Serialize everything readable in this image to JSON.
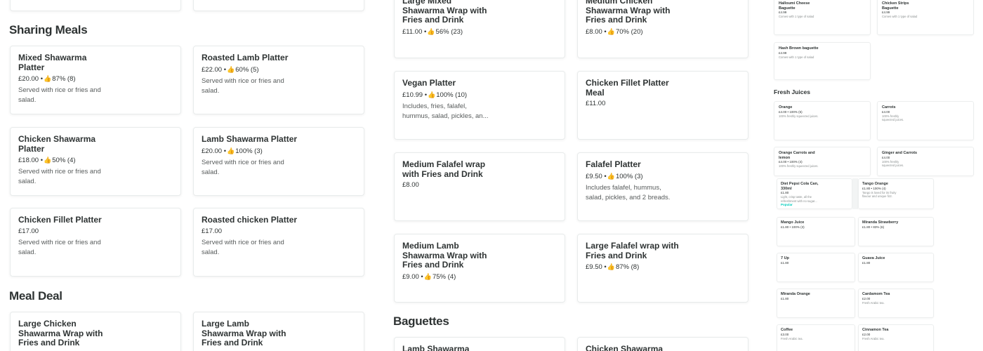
{
  "sections": {
    "sharing_meals": "Sharing Meals",
    "meal_deal": "Meal Deal",
    "baguettes": "Baguettes",
    "fresh_juices": "Fresh Juices"
  },
  "rating_icon": "thumbs-up-icon",
  "col1": {
    "mixed_shawarma_platter": {
      "name": "Mixed Shawarma Platter",
      "price": "£20.00 •",
      "rating": "87% (8)",
      "desc": "Served with rice or fries and salad."
    },
    "roasted_lamb_platter": {
      "name": "Roasted Lamb Platter",
      "price": "£22.00 •",
      "rating": "60% (5)",
      "desc": "Served with rice or fries and salad."
    },
    "chicken_shawarma_platter": {
      "name": "Chicken Shawarma Platter",
      "price": "£18.00 •",
      "rating": "50% (4)",
      "desc": "Served with rice or fries and salad."
    },
    "lamb_shawarma_platter": {
      "name": "Lamb Shawarma Platter",
      "price": "£20.00 •",
      "rating": "100% (3)",
      "desc": "Served with rice or fries and salad."
    },
    "chicken_fillet_platter": {
      "name": "Chicken Fillet Platter",
      "price": "£17.00",
      "desc": "Served with rice or fries and salad."
    },
    "roasted_chicken_platter": {
      "name": "Roasted chicken Platter",
      "price": "£17.00",
      "desc": "Served with rice or fries and salad."
    },
    "large_chicken_wrap_meal": {
      "name": "Large Chicken Shawarma Wrap with Fries and Drink"
    },
    "large_lamb_wrap_meal": {
      "name": "Large Lamb Shawarma Wrap with Fries and Drink"
    }
  },
  "col2": {
    "large_mixed_wrap": {
      "name": "Large Mixed Shawarma Wrap with Fries and Drink",
      "price": "£11.00 •",
      "rating": "56% (23)"
    },
    "medium_chicken_wrap": {
      "name": "Medium Chicken Shawarma Wrap with Fries and Drink",
      "price": "£8.00 •",
      "rating": "70% (20)"
    },
    "vegan_platter": {
      "name": "Vegan Platter",
      "price": "£10.99 •",
      "rating": "100% (10)",
      "desc": "Includes, fries, falafel, hummus, salad, pickles, an..."
    },
    "chicken_fillet_platter_meal": {
      "name": "Chicken Fillet Platter Meal",
      "price": "£11.00"
    },
    "medium_falafel_wrap": {
      "name": "Medium Falafel wrap with Fries and Drink",
      "price": "£8.00"
    },
    "falafel_platter": {
      "name": "Falafel Platter",
      "price": "£9.50 •",
      "rating": "100% (3)",
      "desc": "Includes falafel, hummus, salad, pickles, and 2 breads."
    },
    "medium_lamb_wrap": {
      "name": "Medium Lamb Shawarma Wrap with Fries and Drink",
      "price": "£9.00 •",
      "rating": "75% (4)"
    },
    "large_falafel_wrap": {
      "name": "Large Falafel wrap with Fries and Drink",
      "price": "£9.50 •",
      "rating": "87% (8)"
    },
    "lamb_shawarma_baguette": {
      "name": "Lamb Shawarma"
    },
    "chicken_shawarma_baguette": {
      "name": "Chicken Shawarma"
    }
  },
  "col3": {
    "halloumi_baguette": {
      "name": "Halloumi Cheese Baguette",
      "price": "£4.99",
      "desc": "Comes with 1 type of salad"
    },
    "chicken_strips_baguette": {
      "name": "Chicken Strips Baguette",
      "price": "£4.99",
      "desc": "Comes with 1 type of salad"
    },
    "hash_brown_baguette": {
      "name": "Hash Brown baguette",
      "price": "£4.99",
      "desc": "Comes with 1 type of salad"
    },
    "orange": {
      "name": "Orange",
      "price": "£4.00 • 100% (5)",
      "desc": "100% freshly squeezed juices."
    },
    "carrots": {
      "name": "Carrots",
      "price": "£4.00",
      "desc": "100% freshly squeezed juices."
    },
    "orange_carrots_lemon": {
      "name": "Orange Carrots and lemon",
      "price": "£4.00 • 100% (4)",
      "desc": "100% freshly squeezed juices."
    },
    "ginger_carrots": {
      "name": "Ginger and Carrots",
      "price": "£4.00",
      "desc": "100% freshly squeezed juices."
    },
    "diet_pepsi": {
      "name": "Diet Pepsi Cola Can, 330ml",
      "price": "£1.80",
      "desc": "Light, crisp taste, all the refreshment with no sugar...",
      "tag": "Popular"
    },
    "tango_orange": {
      "name": "Tango Orange",
      "price": "£1.80 • 100% (4)",
      "desc": "Tango is loved for its fruity flavour and unique fizz."
    },
    "mango_juice": {
      "name": "Mango Juice",
      "price": "£1.80 • 100% (3)"
    },
    "miranda_strawberry": {
      "name": "Miranda Strawberry",
      "price": "£1.80 • 83% (6)"
    },
    "seven_up": {
      "name": "7 Up",
      "price": "£1.80"
    },
    "guava_juice": {
      "name": "Guava Juice",
      "price": "£1.80"
    },
    "miranda_orange": {
      "name": "Miranda Orange",
      "price": "£1.80"
    },
    "cardamom_tea": {
      "name": "Cardamom Tea",
      "price": "£2.00",
      "desc": "Fresh Arabic tea."
    },
    "coffee": {
      "name": "Coffee",
      "price": "£3.00",
      "desc": "Fresh Arabic tea."
    },
    "cinnamon_tea": {
      "name": "Cinnamon Tea",
      "price": "£2.00",
      "desc": "Fresh Arabic tea."
    }
  }
}
